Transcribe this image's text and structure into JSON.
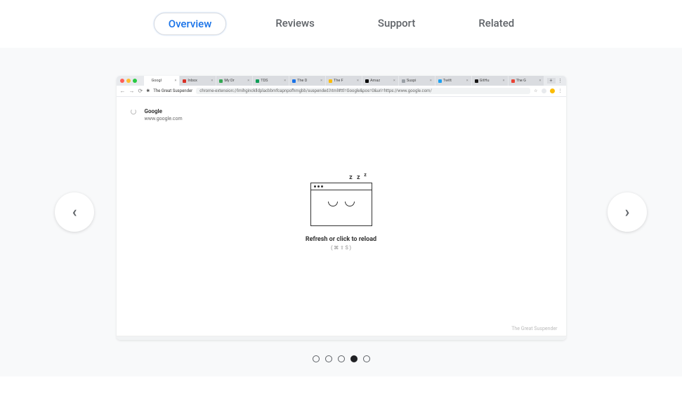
{
  "tabs": {
    "overview": "Overview",
    "reviews": "Reviews",
    "support": "Support",
    "related": "Related"
  },
  "screenshot": {
    "browser_tabs": [
      {
        "fav_color": "#ffffff",
        "label": "Googl",
        "active": true
      },
      {
        "fav_color": "#d93025",
        "label": "Inbox",
        "active": false
      },
      {
        "fav_color": "#34a853",
        "label": "My Dr",
        "active": false
      },
      {
        "fav_color": "#0f9d58",
        "label": "TDS",
        "active": false
      },
      {
        "fav_color": "#1a73e8",
        "label": "The D",
        "active": false
      },
      {
        "fav_color": "#fbbc05",
        "label": "The F",
        "active": false
      },
      {
        "fav_color": "#000000",
        "label": "Amaz",
        "active": false
      },
      {
        "fav_color": "#9aa0a6",
        "label": "Suspi",
        "active": false
      },
      {
        "fav_color": "#1da1f2",
        "label": "Twitt",
        "active": false
      },
      {
        "fav_color": "#181717",
        "label": "GitHu",
        "active": false
      },
      {
        "fav_color": "#ea4335",
        "label": "The G",
        "active": false
      }
    ],
    "url_bar": {
      "title": "The Great Suspender",
      "url": "chrome-extension://lmihgincklldplacbbmfcapnpofhmgbb/suspended.html#ttl=Google&pos=0&uri=https://www.google.com/"
    },
    "page": {
      "title": "Google",
      "subtitle": "www.google.com",
      "zzz": "z z",
      "reload_text": "Refresh or click to reload",
      "shortcut": "( ⌘ ⇧ S )"
    },
    "footer": "The Great Suspender"
  },
  "carousel": {
    "dot_count": 5,
    "active_index": 3
  }
}
